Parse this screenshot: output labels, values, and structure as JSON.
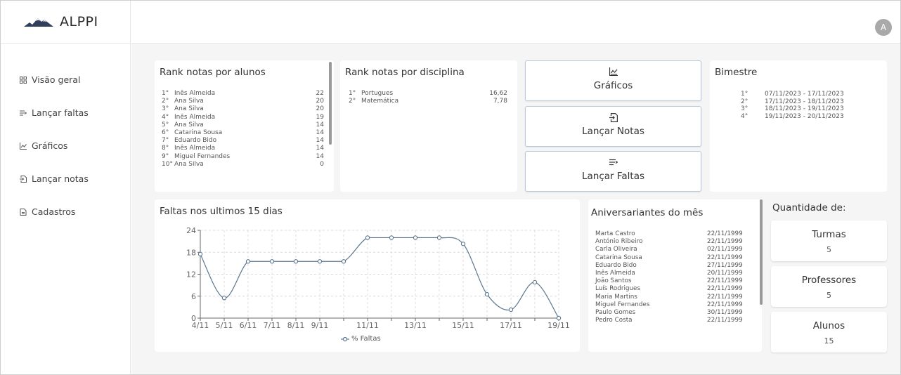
{
  "app": {
    "name": "ALPPI",
    "avatar_initial": "A"
  },
  "sidebar": {
    "items": [
      {
        "label": "Visão geral",
        "icon": "grid-icon"
      },
      {
        "label": "Lançar faltas",
        "icon": "list-arrow-icon"
      },
      {
        "label": "Gráficos",
        "icon": "chart-icon"
      },
      {
        "label": "Lançar notas",
        "icon": "file-import-icon"
      },
      {
        "label": "Cadastros",
        "icon": "document-icon"
      }
    ]
  },
  "rank_alunos": {
    "title": "Rank notas por alunos",
    "rows": [
      {
        "pos": "1°",
        "name": "Inês Almeida",
        "value": "22"
      },
      {
        "pos": "2°",
        "name": "Ana Silva",
        "value": "20"
      },
      {
        "pos": "3°",
        "name": "Ana Silva",
        "value": "20"
      },
      {
        "pos": "4°",
        "name": "Inês Almeida",
        "value": "19"
      },
      {
        "pos": "5°",
        "name": "Ana Silva",
        "value": "14"
      },
      {
        "pos": "6°",
        "name": "Catarina Sousa",
        "value": "14"
      },
      {
        "pos": "7°",
        "name": "Eduardo Bido",
        "value": "14"
      },
      {
        "pos": "8°",
        "name": "Inês Almeida",
        "value": "14"
      },
      {
        "pos": "9°",
        "name": "Miguel Fernandes",
        "value": "14"
      },
      {
        "pos": "10°",
        "name": "Ana Silva",
        "value": "0"
      }
    ]
  },
  "rank_disciplina": {
    "title": "Rank notas por disciplina",
    "rows": [
      {
        "pos": "1°",
        "name": "Portugues",
        "value": "16,62"
      },
      {
        "pos": "2°",
        "name": "Matemática",
        "value": "7,78"
      }
    ]
  },
  "actions": {
    "graficos": {
      "label": "Gráficos",
      "icon": "chart-icon"
    },
    "lancar_notas": {
      "label": "Lançar Notas",
      "icon": "file-import-icon"
    },
    "lancar_faltas": {
      "label": "Lançar Faltas",
      "icon": "list-arrow-icon"
    }
  },
  "bimestre": {
    "title": "Bimestre",
    "rows": [
      {
        "pos": "1°",
        "range": "07/11/2023 - 17/11/2023"
      },
      {
        "pos": "2°",
        "range": "17/11/2023 - 18/11/2023"
      },
      {
        "pos": "3°",
        "range": "18/11/2023 - 19/11/2023"
      },
      {
        "pos": "4°",
        "range": "19/11/2023 - 20/11/2023"
      }
    ]
  },
  "faltas": {
    "title": "Faltas nos ultimos 15 dias",
    "legend": "% Faltas"
  },
  "chart_data": {
    "type": "line",
    "title": "Faltas nos ultimos 15 dias",
    "x": [
      "4/11",
      "5/11",
      "6/11",
      "7/11",
      "8/11",
      "9/11",
      "10/11",
      "11/11",
      "12/11",
      "13/11",
      "14/11",
      "15/11",
      "16/11",
      "17/11",
      "18/11",
      "19/11"
    ],
    "x_tick_labels": [
      "4/11",
      "5/11",
      "6/11",
      "7/11",
      "8/11",
      "9/11",
      "",
      "11/11",
      "",
      "13/11",
      "",
      "15/11",
      "",
      "17/11",
      "",
      "19/11"
    ],
    "series": [
      {
        "name": "% Faltas",
        "values": [
          17.5,
          5.5,
          15.5,
          15.5,
          15.5,
          15.5,
          15.5,
          22,
          22,
          22,
          22,
          20.3,
          6.5,
          2.3,
          9.8,
          0
        ],
        "color": "#5b7590"
      }
    ],
    "y_ticks": [
      0,
      6,
      12,
      18,
      24
    ],
    "ylim": [
      0,
      24
    ],
    "grid": true,
    "legend_position": "bottom"
  },
  "aniversariantes": {
    "title": "Aniversariantes do mês",
    "rows": [
      {
        "name": "Marta Castro",
        "date": "22/11/1999"
      },
      {
        "name": "António Ribeiro",
        "date": "22/11/1999"
      },
      {
        "name": "Carla Oliveira",
        "date": "02/11/1999"
      },
      {
        "name": "Catarina Sousa",
        "date": "22/11/1999"
      },
      {
        "name": "Eduardo Bido",
        "date": "27/11/1999"
      },
      {
        "name": "Inês Almeida",
        "date": "20/11/1999"
      },
      {
        "name": "João Santos",
        "date": "22/11/1999"
      },
      {
        "name": "Luís Rodrigues",
        "date": "22/11/1999"
      },
      {
        "name": "Maria Martins",
        "date": "22/11/1999"
      },
      {
        "name": "Miguel Fernandes",
        "date": "22/11/1999"
      },
      {
        "name": "Paulo Gomes",
        "date": "30/11/1999"
      },
      {
        "name": "Pedro Costa",
        "date": "22/11/1999"
      }
    ]
  },
  "quantidade": {
    "title": "Quantidade de:",
    "turmas": {
      "label": "Turmas",
      "value": "5"
    },
    "professores": {
      "label": "Professores",
      "value": "5"
    },
    "alunos": {
      "label": "Alunos",
      "value": "15"
    }
  }
}
